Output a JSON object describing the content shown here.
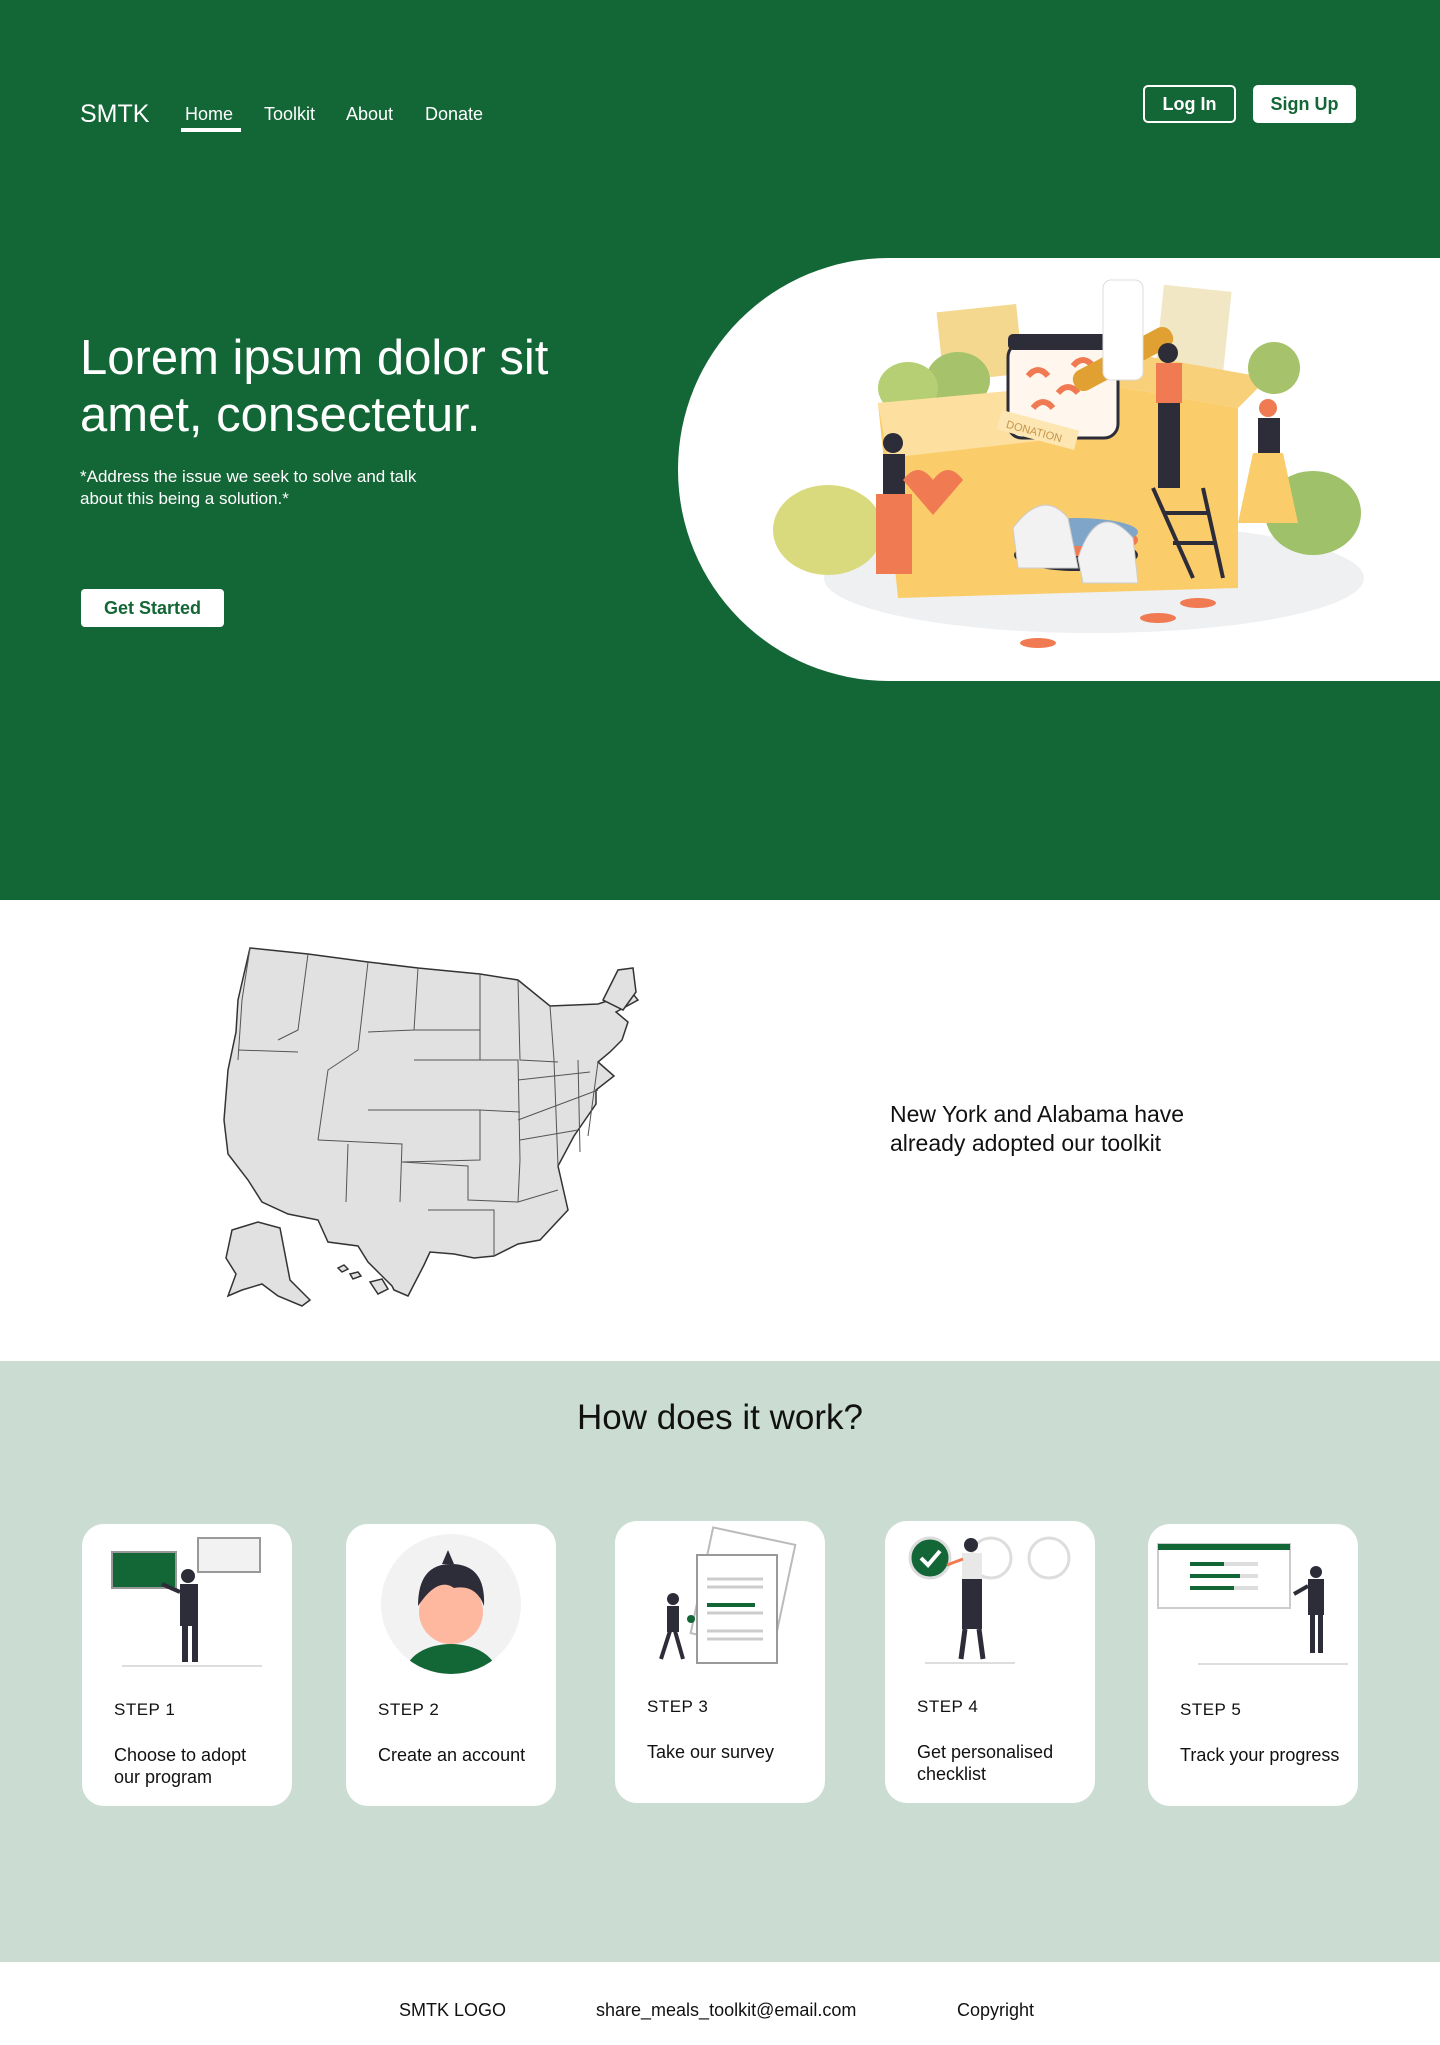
{
  "header": {
    "brand": "SMTK",
    "nav": [
      "Home",
      "Toolkit",
      "About",
      "Donate"
    ],
    "active_nav": "Home",
    "login_label": "Log In",
    "signup_label": "Sign Up"
  },
  "hero": {
    "title": "Lorem ipsum dolor sit amet, consectetur.",
    "subtitle": "*Address the issue we seek to solve and talk about this being a solution.*",
    "cta_label": "Get Started",
    "illustration_text": "DONATION"
  },
  "adoption": {
    "text": "New York and Alabama have already adopted our toolkit"
  },
  "how": {
    "title": "How does it work?",
    "steps": [
      {
        "step": "STEP 1",
        "desc": "Choose to adopt our program"
      },
      {
        "step": "STEP 2",
        "desc": "Create an account"
      },
      {
        "step": "STEP 3",
        "desc": "Take our survey"
      },
      {
        "step": "STEP 4",
        "desc": "Get personalised checklist"
      },
      {
        "step": "STEP 5",
        "desc": "Track your progress"
      }
    ]
  },
  "footer": {
    "logo": "SMTK LOGO",
    "email": "share_meals_toolkit@email.com",
    "copyright": "Copyright"
  },
  "colors": {
    "brand_green": "#136636",
    "section_mint": "#cbddd3",
    "accent_orange": "#f07a52",
    "accent_yellow": "#fbcc6a"
  }
}
